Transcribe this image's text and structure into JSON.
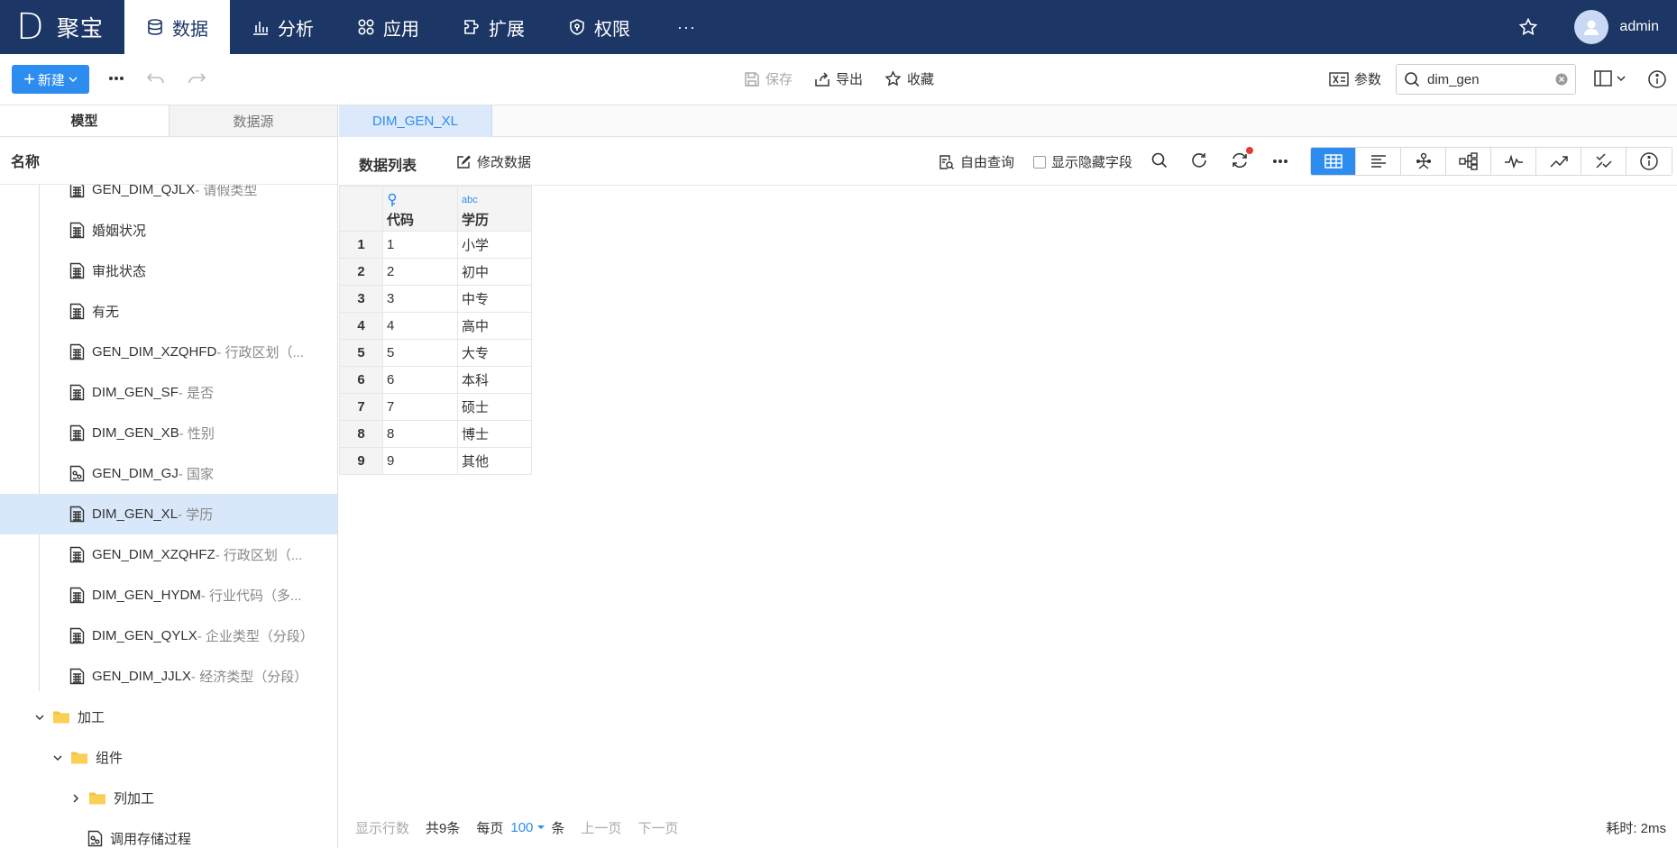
{
  "app": {
    "logo_mark": "D",
    "logo_text": "聚宝",
    "user": "admin"
  },
  "nav": [
    {
      "label": "数据",
      "icon": "database-icon",
      "active": true
    },
    {
      "label": "分析",
      "icon": "bar-chart-icon"
    },
    {
      "label": "应用",
      "icon": "apps-icon"
    },
    {
      "label": "扩展",
      "icon": "extension-icon"
    },
    {
      "label": "权限",
      "icon": "shield-icon"
    },
    {
      "label": "···",
      "icon": "more-icon"
    }
  ],
  "toolbar": {
    "new_label": "新建",
    "save_label": "保存",
    "export_label": "导出",
    "favorite_label": "收藏",
    "param_label": "参数",
    "search_value": "dim_gen"
  },
  "left": {
    "tabs": [
      "模型",
      "数据源"
    ],
    "header": "名称",
    "tree": [
      {
        "code": "GEN_DIM_QJLX",
        "desc": " - 请假类型",
        "icon": "table-icon",
        "indent": 1
      },
      {
        "code": "婚姻状况",
        "desc": "",
        "icon": "table-icon",
        "indent": 1
      },
      {
        "code": "审批状态",
        "desc": "",
        "icon": "table-icon",
        "indent": 1
      },
      {
        "code": "有无",
        "desc": "",
        "icon": "table-icon",
        "indent": 1
      },
      {
        "code": "GEN_DIM_XZQHFD",
        "desc": " - 行政区划（...",
        "icon": "table-icon",
        "indent": 1
      },
      {
        "code": "DIM_GEN_SF",
        "desc": " - 是否",
        "icon": "table-icon",
        "indent": 1
      },
      {
        "code": "DIM_GEN_XB",
        "desc": " - 性别",
        "icon": "table-icon",
        "indent": 1
      },
      {
        "code": "GEN_DIM_GJ",
        "desc": " - 国家",
        "icon": "linked-table-icon",
        "indent": 1
      },
      {
        "code": "DIM_GEN_XL",
        "desc": " - 学历",
        "icon": "table-icon",
        "indent": 1,
        "selected": true
      },
      {
        "code": "GEN_DIM_XZQHFZ",
        "desc": " - 行政区划（...",
        "icon": "table-icon",
        "indent": 1
      },
      {
        "code": "DIM_GEN_HYDM",
        "desc": " - 行业代码（多...",
        "icon": "table-icon",
        "indent": 1
      },
      {
        "code": "DIM_GEN_QYLX",
        "desc": " - 企业类型（分段）",
        "icon": "table-icon",
        "indent": 1
      },
      {
        "code": "GEN_DIM_JJLX",
        "desc": " - 经济类型（分段）",
        "icon": "table-icon",
        "indent": 1
      },
      {
        "code": "加工",
        "desc": "",
        "icon": "folder-icon",
        "indent": 0,
        "chevron": "down"
      },
      {
        "code": "组件",
        "desc": "",
        "icon": "folder-icon",
        "indent": 1,
        "chevron": "down"
      },
      {
        "code": "列加工",
        "desc": "",
        "icon": "folder-icon",
        "indent": 2,
        "chevron": "right"
      },
      {
        "code": "调用存储过程",
        "desc": "",
        "icon": "linked-table-icon",
        "indent": 3
      }
    ]
  },
  "main": {
    "tab_label": "DIM_GEN_XL",
    "title": "数据列表",
    "edit_label": "修改数据",
    "free_query_label": "自由查询",
    "show_hidden_label": "显示隐藏字段",
    "columns": [
      {
        "type_icon": "key-icon",
        "name": "代码"
      },
      {
        "type_icon": "abc",
        "name": "学历"
      }
    ],
    "rows": [
      {
        "n": "1",
        "code": "1",
        "name": "小学"
      },
      {
        "n": "2",
        "code": "2",
        "name": "初中"
      },
      {
        "n": "3",
        "code": "3",
        "name": "中专"
      },
      {
        "n": "4",
        "code": "4",
        "name": "高中"
      },
      {
        "n": "5",
        "code": "5",
        "name": "大专"
      },
      {
        "n": "6",
        "code": "6",
        "name": "本科"
      },
      {
        "n": "7",
        "code": "7",
        "name": "硕士"
      },
      {
        "n": "8",
        "code": "8",
        "name": "博士"
      },
      {
        "n": "9",
        "code": "9",
        "name": "其他"
      }
    ],
    "footer": {
      "show_rows": "显示行数",
      "total": "共9条",
      "per_page_prefix": "每页",
      "per_page_value": "100",
      "per_page_suffix": "条",
      "prev": "上一页",
      "next": "下一页",
      "elapsed": "耗时: 2ms"
    }
  },
  "colors": {
    "nav_bg": "#1c3665",
    "accent": "#2d8cf0",
    "selected_row": "#d8e7f9"
  }
}
